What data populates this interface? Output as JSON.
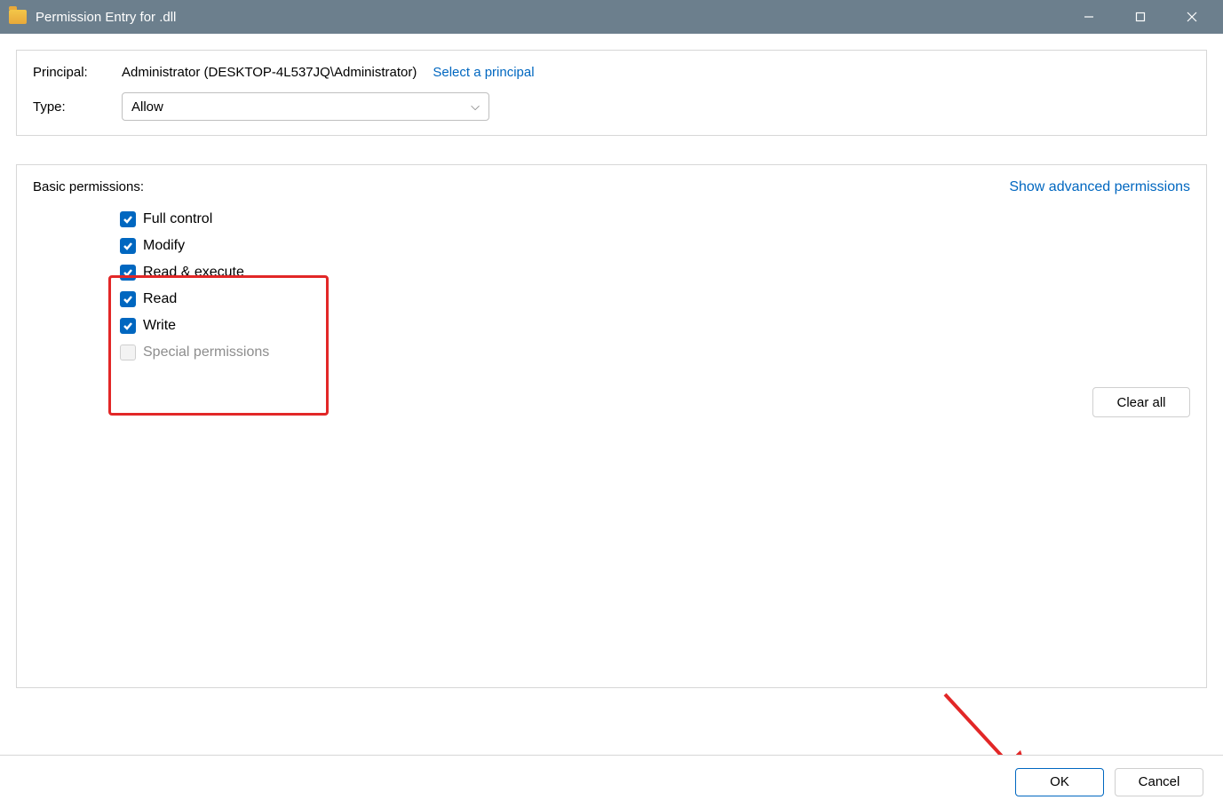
{
  "titlebar": {
    "title": "Permission Entry for          .dll"
  },
  "principal": {
    "label": "Principal:",
    "value": "Administrator (DESKTOP-4L537JQ\\Administrator)",
    "select_link": "Select a principal"
  },
  "type": {
    "label": "Type:",
    "value": "Allow"
  },
  "permissions": {
    "header": "Basic permissions:",
    "advanced_link": "Show advanced permissions",
    "items": [
      {
        "label": "Full control",
        "checked": true,
        "enabled": true
      },
      {
        "label": "Modify",
        "checked": true,
        "enabled": true
      },
      {
        "label": "Read & execute",
        "checked": true,
        "enabled": true
      },
      {
        "label": "Read",
        "checked": true,
        "enabled": true
      },
      {
        "label": "Write",
        "checked": true,
        "enabled": true
      },
      {
        "label": "Special permissions",
        "checked": false,
        "enabled": false
      }
    ],
    "clear_all": "Clear all"
  },
  "footer": {
    "ok": "OK",
    "cancel": "Cancel"
  },
  "annotations": {
    "highlight_color": "#e22727",
    "arrow_color": "#e22727"
  }
}
